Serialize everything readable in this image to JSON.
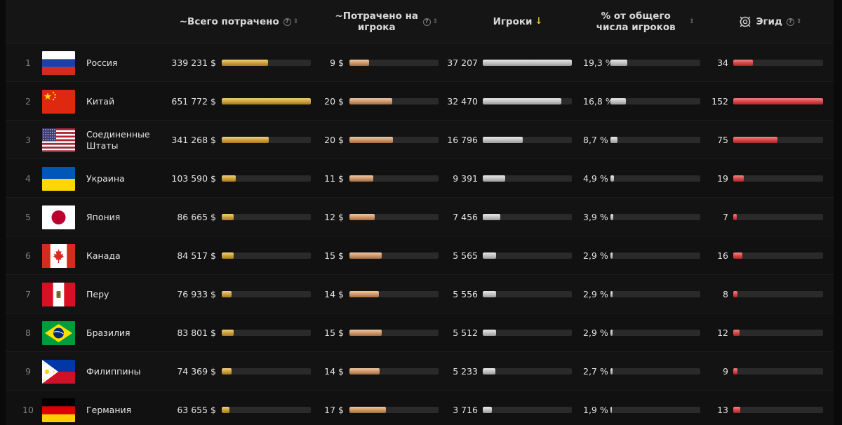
{
  "header": {
    "total_spent": "~Всего потрачено",
    "per_player": "~Потрачено на игрока",
    "players": "Игроки",
    "percent": "% от общего числа игроков",
    "aegis": "Эгид",
    "help_glyph": "?",
    "sort_glyph": "⇕",
    "sort_down_glyph": "↓"
  },
  "colors": {
    "total_spent_bar": "#d0a23c",
    "per_player_bar": "#c99164",
    "players_bar": "#bdbdbd",
    "percent_bar": "#8a8a8a",
    "aegis_bar": "#d44040"
  },
  "rows": [
    {
      "rank": "1",
      "flag": "russia",
      "country": "Россия",
      "total": "339 231 $",
      "total_frac": 0.52,
      "per": "9 $",
      "per_frac": 0.22,
      "players": "37 207",
      "players_frac": 1.0,
      "percent": "19,3 %",
      "percent_frac": 0.19,
      "aegis": "34",
      "aegis_frac": 0.22
    },
    {
      "rank": "2",
      "flag": "china",
      "country": "Китай",
      "total": "651 772 $",
      "total_frac": 1.0,
      "per": "20 $",
      "per_frac": 0.48,
      "players": "32 470",
      "players_frac": 0.88,
      "percent": "16,8 %",
      "percent_frac": 0.17,
      "aegis": "152",
      "aegis_frac": 1.0
    },
    {
      "rank": "3",
      "flag": "usa",
      "country": "Соединенные Штаты",
      "total": "341 268 $",
      "total_frac": 0.53,
      "per": "20 $",
      "per_frac": 0.49,
      "players": "16 796",
      "players_frac": 0.45,
      "percent": "8,7 %",
      "percent_frac": 0.08,
      "aegis": "75",
      "aegis_frac": 0.49
    },
    {
      "rank": "4",
      "flag": "ukraine",
      "country": "Украина",
      "total": "103 590 $",
      "total_frac": 0.16,
      "per": "11 $",
      "per_frac": 0.27,
      "players": "9 391",
      "players_frac": 0.25,
      "percent": "4,9 %",
      "percent_frac": 0.04,
      "aegis": "19",
      "aegis_frac": 0.12
    },
    {
      "rank": "5",
      "flag": "japan",
      "country": "Япония",
      "total": "86 665 $",
      "total_frac": 0.13,
      "per": "12 $",
      "per_frac": 0.28,
      "players": "7 456",
      "players_frac": 0.2,
      "percent": "3,9 %",
      "percent_frac": 0.03,
      "aegis": "7",
      "aegis_frac": 0.04
    },
    {
      "rank": "6",
      "flag": "canada",
      "country": "Канада",
      "total": "84 517 $",
      "total_frac": 0.13,
      "per": "15 $",
      "per_frac": 0.36,
      "players": "5 565",
      "players_frac": 0.15,
      "percent": "2,9 %",
      "percent_frac": 0.02,
      "aegis": "16",
      "aegis_frac": 0.1
    },
    {
      "rank": "7",
      "flag": "peru",
      "country": "Перу",
      "total": "76 933 $",
      "total_frac": 0.11,
      "per": "14 $",
      "per_frac": 0.33,
      "players": "5 556",
      "players_frac": 0.15,
      "percent": "2,9 %",
      "percent_frac": 0.02,
      "aegis": "8",
      "aegis_frac": 0.05
    },
    {
      "rank": "8",
      "flag": "brazil",
      "country": "Бразилия",
      "total": "83 801 $",
      "total_frac": 0.13,
      "per": "15 $",
      "per_frac": 0.36,
      "players": "5 512",
      "players_frac": 0.15,
      "percent": "2,9 %",
      "percent_frac": 0.02,
      "aegis": "12",
      "aegis_frac": 0.07
    },
    {
      "rank": "9",
      "flag": "philippines",
      "country": "Филиппины",
      "total": "74 369 $",
      "total_frac": 0.11,
      "per": "14 $",
      "per_frac": 0.34,
      "players": "5 233",
      "players_frac": 0.14,
      "percent": "2,7 %",
      "percent_frac": 0.02,
      "aegis": "9",
      "aegis_frac": 0.05
    },
    {
      "rank": "10",
      "flag": "germany",
      "country": "Германия",
      "total": "63 655 $",
      "total_frac": 0.09,
      "per": "17 $",
      "per_frac": 0.41,
      "players": "3 716",
      "players_frac": 0.1,
      "percent": "1,9 %",
      "percent_frac": 0.01,
      "aegis": "13",
      "aegis_frac": 0.08
    }
  ]
}
